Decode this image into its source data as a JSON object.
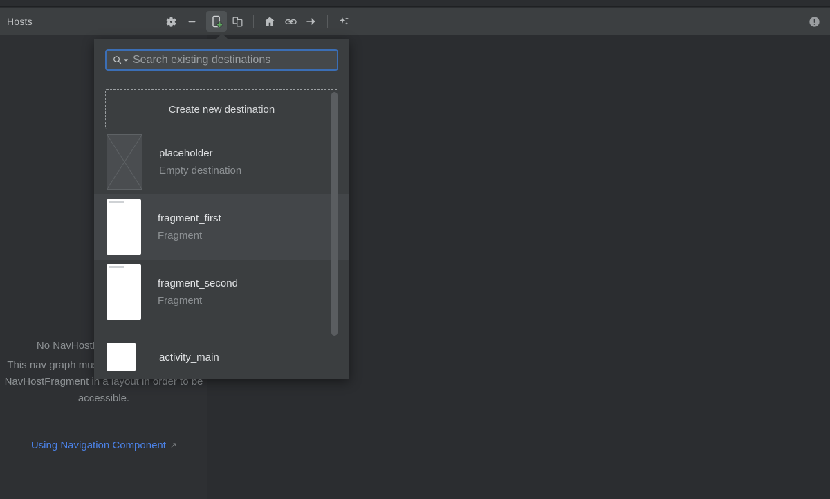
{
  "toolbar": {
    "title": "Hosts",
    "buttons": [
      {
        "name": "gear-icon",
        "label": "Settings"
      },
      {
        "name": "minus-icon",
        "label": "Zoom out"
      },
      {
        "name": "new-destination-icon",
        "label": "New Destination",
        "selected": true
      },
      {
        "name": "new-nested-graph-icon",
        "label": "New Nested Graph"
      },
      {
        "name": "home-icon",
        "label": "Set Start Destination"
      },
      {
        "name": "link-icon",
        "label": "New Deep Link"
      },
      {
        "name": "arrow-right-icon",
        "label": "New Action"
      },
      {
        "name": "sparkle-icon",
        "label": "Auto Arrange"
      }
    ],
    "status_icon": "warning-icon"
  },
  "search": {
    "placeholder": "Search existing destinations",
    "value": "",
    "icon": "search-icon"
  },
  "popup": {
    "create_label": "Create new destination",
    "items": [
      {
        "title": "placeholder",
        "subtitle": "Empty destination",
        "thumb": "placeholder-thumb",
        "highlighted": false
      },
      {
        "title": "fragment_first",
        "subtitle": "Fragment",
        "thumb": "fragment-thumb",
        "highlighted": true
      },
      {
        "title": "fragment_second",
        "subtitle": "Fragment",
        "thumb": "fragment-thumb",
        "highlighted": false
      },
      {
        "title": "activity_main",
        "subtitle": "",
        "thumb": "activity-thumb",
        "highlighted": false
      }
    ]
  },
  "canvas": {
    "empty_title": "No NavHostFragments found",
    "empty_body": "This nav graph must be referenced from a NavHostFragment in a layout in order to be accessible.",
    "link_label": "Using Navigation Component",
    "link_icon": "external-link-icon"
  },
  "colors": {
    "accent_blue": "#4b82e8",
    "focus_border": "#3b6eb5",
    "green_plus": "#5da95d",
    "panel_bg": "#3b3e40",
    "toolbar_bg": "#3c3f41",
    "canvas_bg": "#2b2d30"
  }
}
